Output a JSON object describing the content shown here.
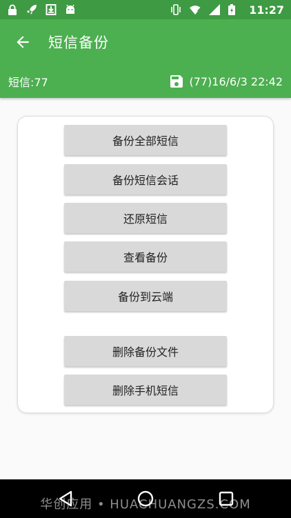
{
  "status_bar": {
    "time": "11:27",
    "left_icons": [
      "lock-icon",
      "rocket-icon",
      "download-icon",
      "android-icon"
    ],
    "right_icons": [
      "vibrate-icon",
      "wifi-icon",
      "signal-icon",
      "battery-charging-icon"
    ]
  },
  "app_bar": {
    "title": "短信备份",
    "back_icon": "arrow-left-icon"
  },
  "info_bar": {
    "sms_count": "短信:77",
    "last_backup": "(77)16/6/3 22:42",
    "backup_icon": "floppy-disk-icon"
  },
  "actions": {
    "backup_all": "备份全部短信",
    "backup_conversation": "备份短信会话",
    "restore": "还原短信",
    "view_backup": "查看备份",
    "backup_cloud": "备份到云端",
    "delete_backup_file": "删除备份文件",
    "delete_phone_sms": "删除手机短信"
  },
  "nav_bar": {
    "icons": [
      "back-triangle-icon",
      "home-circle-icon",
      "recents-square-icon"
    ]
  },
  "watermark": "华创应用 • HUACHUANGZS.COM",
  "colors": {
    "primary": "#4caf50",
    "status_bar": "#3e9a43",
    "button": "#d9d9d9"
  }
}
